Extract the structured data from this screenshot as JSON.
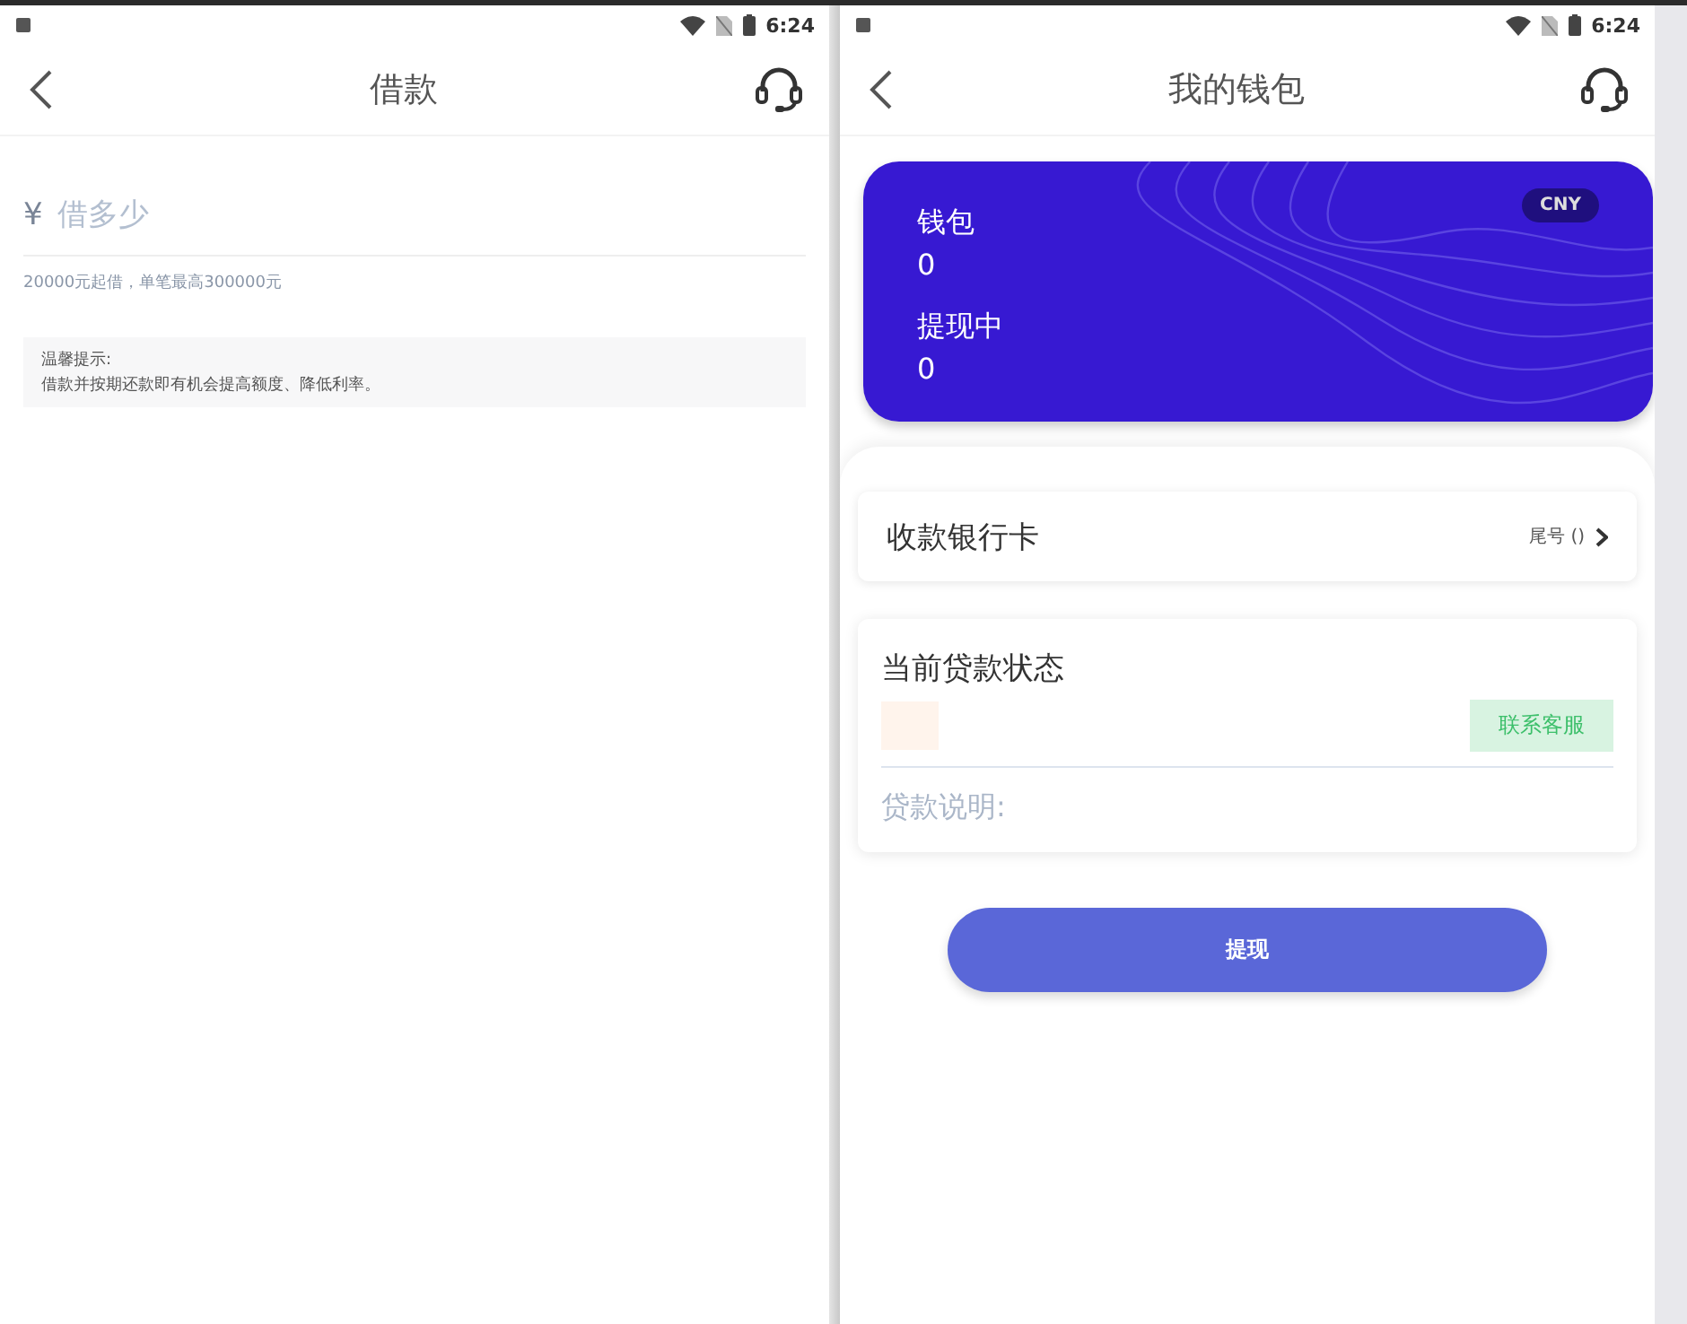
{
  "left_screen": {
    "status_bar": {
      "time": "6:24"
    },
    "header": {
      "title": "借款"
    },
    "amount_field": {
      "currency": "¥",
      "placeholder": "借多少"
    },
    "limit_hint": "20000元起借，单笔最高300000元",
    "tip": {
      "title": "温馨提示:",
      "text": "借款并按期还款即有机会提高额度、降低利率。"
    }
  },
  "right_screen": {
    "status_bar": {
      "time": "6:24"
    },
    "header": {
      "title": "我的钱包"
    },
    "wallet_card": {
      "currency_badge": "CNY",
      "items": [
        {
          "label": "钱包",
          "value": "0"
        },
        {
          "label": "提现中",
          "value": "0"
        }
      ]
    },
    "bank_card_row": {
      "label": "收款银行卡",
      "tail": "尾号 ()"
    },
    "loan_status": {
      "title": "当前贷款状态",
      "contact_button": "联系客服",
      "note_label": "贷款说明:"
    },
    "withdraw_button": "提现"
  }
}
